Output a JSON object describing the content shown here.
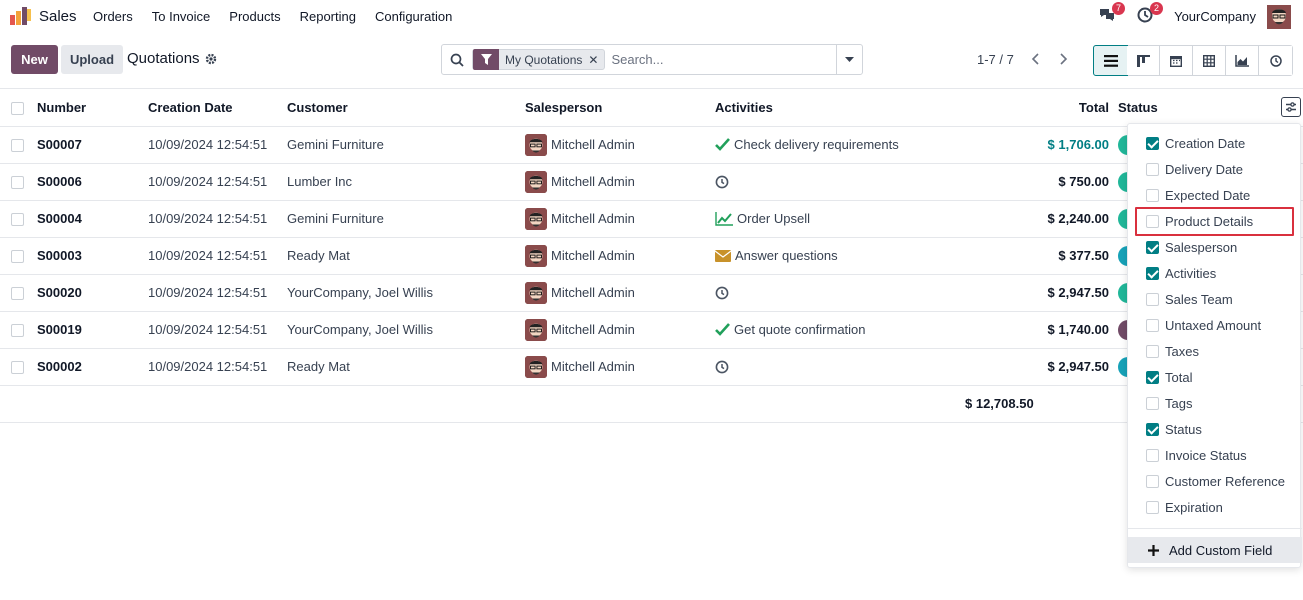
{
  "app": {
    "name": "Sales"
  },
  "menu": [
    "Orders",
    "To Invoice",
    "Products",
    "Reporting",
    "Configuration"
  ],
  "systray": {
    "messages_count": "7",
    "activities_count": "2",
    "company": "YourCompany"
  },
  "control": {
    "new_label": "New",
    "upload_label": "Upload",
    "breadcrumb": "Quotations",
    "facet": "My Quotations",
    "search_placeholder": "Search...",
    "pager": "1-7 / 7"
  },
  "columns": {
    "number": "Number",
    "creation_date": "Creation Date",
    "customer": "Customer",
    "salesperson": "Salesperson",
    "activities": "Activities",
    "total": "Total",
    "status": "Status"
  },
  "rows": [
    {
      "number": "S00007",
      "date": "10/09/2024 12:54:51",
      "customer": "Gemini Furniture",
      "salesperson": "Mitchell Admin",
      "activity": "Check delivery requirements",
      "activity_icon": "check-icon",
      "total": "$ 1,706.00",
      "status_color": "#21b799"
    },
    {
      "number": "S00006",
      "date": "10/09/2024 12:54:51",
      "customer": "Lumber Inc",
      "salesperson": "Mitchell Admin",
      "activity": "",
      "activity_icon": "clock-icon",
      "total": "$ 750.00",
      "status_color": "#21b799"
    },
    {
      "number": "S00004",
      "date": "10/09/2024 12:54:51",
      "customer": "Gemini Furniture",
      "salesperson": "Mitchell Admin",
      "activity": "Order Upsell",
      "activity_icon": "chart-up-icon",
      "total": "$ 2,240.00",
      "status_color": "#21b799"
    },
    {
      "number": "S00003",
      "date": "10/09/2024 12:54:51",
      "customer": "Ready Mat",
      "salesperson": "Mitchell Admin",
      "activity": "Answer questions",
      "activity_icon": "envelope-icon",
      "total": "$ 377.50",
      "status_color": "#17a2b8"
    },
    {
      "number": "S00020",
      "date": "10/09/2024 12:54:51",
      "customer": "YourCompany, Joel Willis",
      "salesperson": "Mitchell Admin",
      "activity": "",
      "activity_icon": "clock-icon",
      "total": "$ 2,947.50",
      "status_color": "#21b799"
    },
    {
      "number": "S00019",
      "date": "10/09/2024 12:54:51",
      "customer": "YourCompany, Joel Willis",
      "salesperson": "Mitchell Admin",
      "activity": "Get quote confirmation",
      "activity_icon": "check-icon",
      "total": "$ 1,740.00",
      "status_color": "#714b67"
    },
    {
      "number": "S00002",
      "date": "10/09/2024 12:54:51",
      "customer": "Ready Mat",
      "salesperson": "Mitchell Admin",
      "activity": "",
      "activity_icon": "clock-icon",
      "total": "$ 2,947.50",
      "status_color": "#17a2b8"
    }
  ],
  "grand_total": "$ 12,708.50",
  "optional_fields": [
    {
      "label": "Creation Date",
      "checked": true
    },
    {
      "label": "Delivery Date",
      "checked": false
    },
    {
      "label": "Expected Date",
      "checked": false
    },
    {
      "label": "Product Details",
      "checked": false
    },
    {
      "label": "Salesperson",
      "checked": true
    },
    {
      "label": "Activities",
      "checked": true
    },
    {
      "label": "Sales Team",
      "checked": false
    },
    {
      "label": "Untaxed Amount",
      "checked": false
    },
    {
      "label": "Taxes",
      "checked": false
    },
    {
      "label": "Total",
      "checked": true
    },
    {
      "label": "Tags",
      "checked": false
    },
    {
      "label": "Status",
      "checked": true
    },
    {
      "label": "Invoice Status",
      "checked": false
    },
    {
      "label": "Customer Reference",
      "checked": false
    },
    {
      "label": "Expiration",
      "checked": false
    }
  ],
  "add_custom_field": "Add Custom Field"
}
